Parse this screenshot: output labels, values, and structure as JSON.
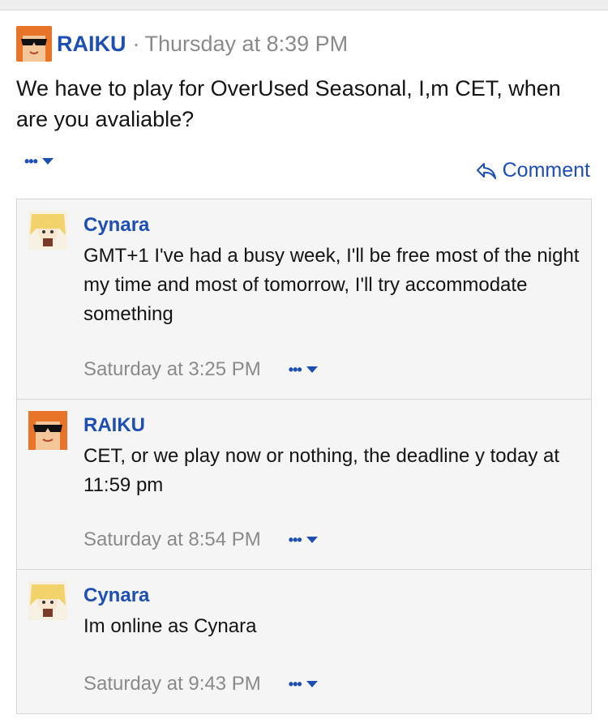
{
  "post": {
    "author": "RAIKU",
    "separator": "·",
    "time": "Thursday at 8:39 PM",
    "body": "We have to play for OverUsed Seasonal, I,m CET, when are you avaliable?",
    "more_dots": "•••",
    "comment_label": "Comment"
  },
  "replies": [
    {
      "author": "Cynara",
      "text": "GMT+1 I've had a busy week, I'll be free most of the night my time and most of tomorrow, I'll try accommodate something",
      "time": "Saturday at 3:25 PM",
      "more_dots": "•••"
    },
    {
      "author": "RAIKU",
      "text": "CET, or we play now or nothing, the deadline y today at 11:59 pm",
      "time": "Saturday at 8:54 PM",
      "more_dots": "•••"
    },
    {
      "author": "Cynara",
      "text": "Im online as Cynara",
      "time": "Saturday at 9:43 PM",
      "more_dots": "•••"
    }
  ],
  "colors": {
    "link": "#1d4fb3",
    "muted": "#8a8a8a",
    "thread_bg": "#f5f5f5"
  },
  "icons": {
    "reply_arrow": "reply-arrow-icon",
    "caret": "caret-down-icon"
  }
}
